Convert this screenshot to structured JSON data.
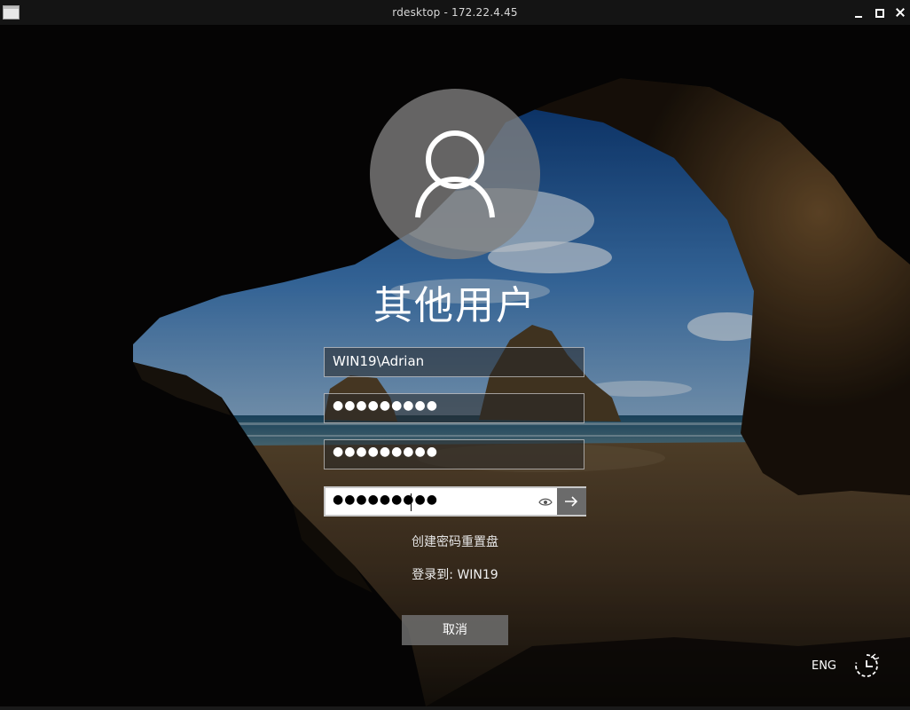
{
  "window": {
    "title": "rdesktop - 172.22.4.45",
    "app_icon": "window-icon",
    "controls": [
      "minimize-icon",
      "maximize-icon",
      "close-icon"
    ]
  },
  "login": {
    "user_title": "其他用户",
    "username_value": "WIN19\\Adrian",
    "password1_value": "●●●●●●●●●",
    "password2_value": "●●●●●●●●●",
    "password3_value": "●●●●●●●●●",
    "reveal_icon": "eye-icon",
    "submit_icon": "arrow-right-icon",
    "reset_disk_link": "创建密码重置盘",
    "sign_in_to": "登录到: WIN19",
    "cancel_label": "取消"
  },
  "tray": {
    "language": "ENG",
    "accessibility_icon": "ease-of-access-icon"
  },
  "colors": {
    "titlebar_bg": "#141414",
    "avatar_bg": "#8a8a8a",
    "submit_bg": "#6b6b6b",
    "cancel_bg": "#6e6e6e"
  }
}
